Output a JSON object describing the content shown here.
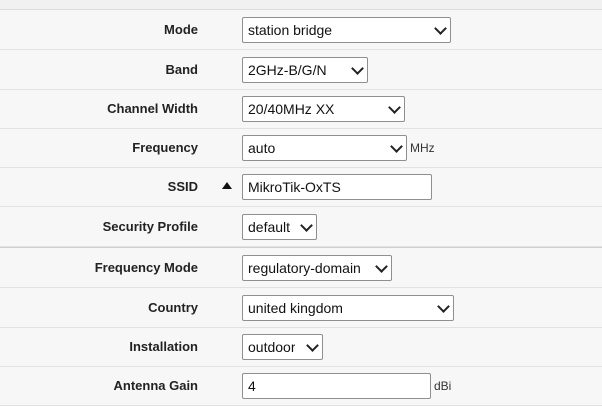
{
  "form": {
    "mode": {
      "label": "Mode",
      "value": "station bridge"
    },
    "band": {
      "label": "Band",
      "value": "2GHz-B/G/N"
    },
    "channel_width": {
      "label": "Channel Width",
      "value": "20/40MHz XX"
    },
    "frequency": {
      "label": "Frequency",
      "value": "auto",
      "unit": "MHz"
    },
    "ssid": {
      "label": "SSID",
      "value": "MikroTik-OxTS",
      "toggle_icon": "triangle-up-icon"
    },
    "security_profile": {
      "label": "Security Profile",
      "value": "default"
    },
    "frequency_mode": {
      "label": "Frequency Mode",
      "value": "regulatory-domain"
    },
    "country": {
      "label": "Country",
      "value": "united kingdom"
    },
    "installation": {
      "label": "Installation",
      "value": "outdoor"
    },
    "antenna_gain": {
      "label": "Antenna Gain",
      "value": "4",
      "unit": "dBi"
    }
  }
}
